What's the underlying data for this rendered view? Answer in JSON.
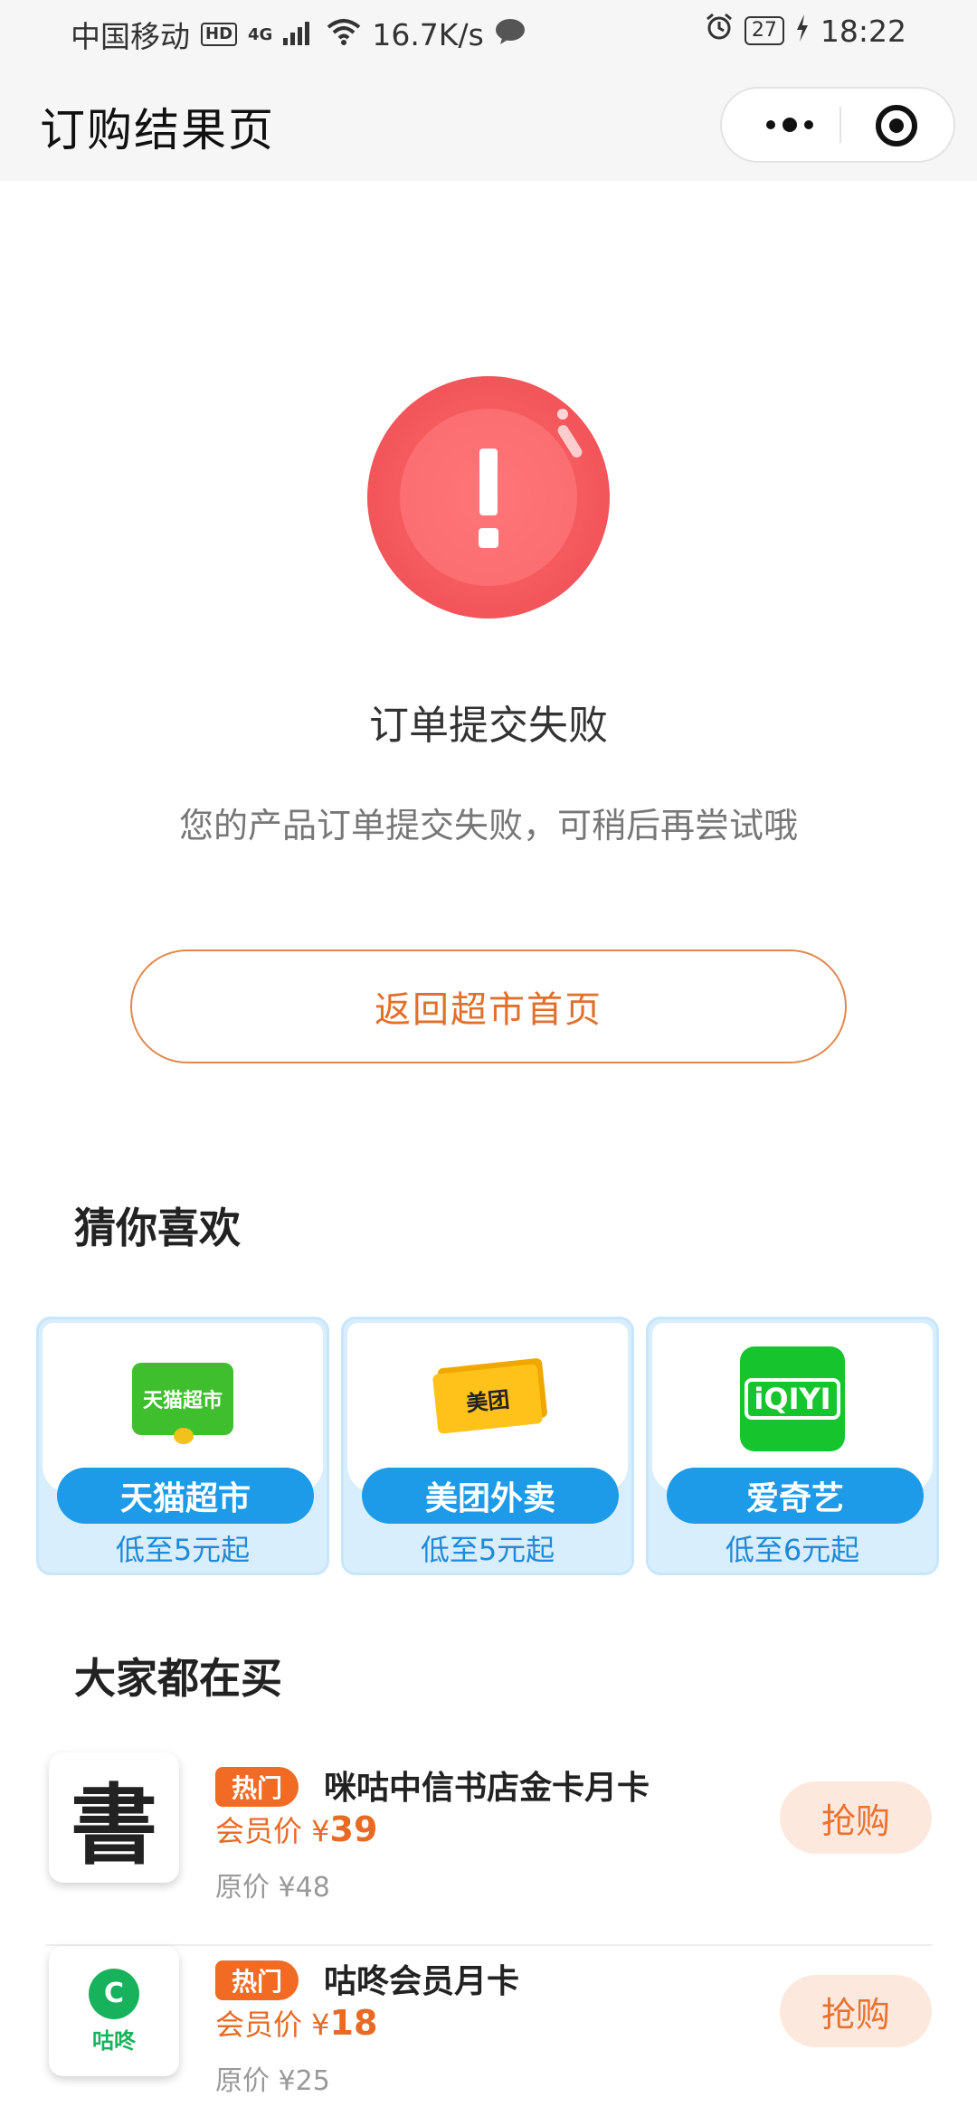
{
  "status_bar": {
    "carrier": "中国移动",
    "hd": "HD",
    "network": "4G",
    "speed": "16.7K/s",
    "battery": "27",
    "time": "18:22"
  },
  "nav": {
    "title": "订购结果页"
  },
  "result": {
    "title": "订单提交失败",
    "description": "您的产品订单提交失败，可稍后再尝试哦",
    "back_button": "返回超市首页",
    "status_color": "#f45a5e"
  },
  "recommend": {
    "title": "猜你喜欢",
    "items": [
      {
        "logo_text": "天猫超市",
        "name": "天猫超市",
        "sub": "低至5元起"
      },
      {
        "logo_text": "美团",
        "name": "美团外卖",
        "sub": "低至5元起"
      },
      {
        "logo_text": "iQIYI",
        "name": "爱奇艺",
        "sub": "低至6元起"
      }
    ]
  },
  "popular": {
    "title": "大家都在买",
    "items": [
      {
        "tag": "热门",
        "name": "咪咕中信书店金卡月卡",
        "member_label": "会员价 ¥",
        "member_price": "39",
        "orig_price": "原价 ¥48",
        "buy": "抢购",
        "thumb": "書"
      },
      {
        "tag": "热门",
        "name": "咕咚会员月卡",
        "member_label": "会员价 ¥",
        "member_price": "18",
        "orig_price": "原价 ¥25",
        "buy": "抢购",
        "thumb": "咕咚"
      }
    ]
  },
  "colors": {
    "accent": "#e26f2a",
    "pill_blue": "#1d9be8",
    "card_bg": "#d8eefc"
  }
}
